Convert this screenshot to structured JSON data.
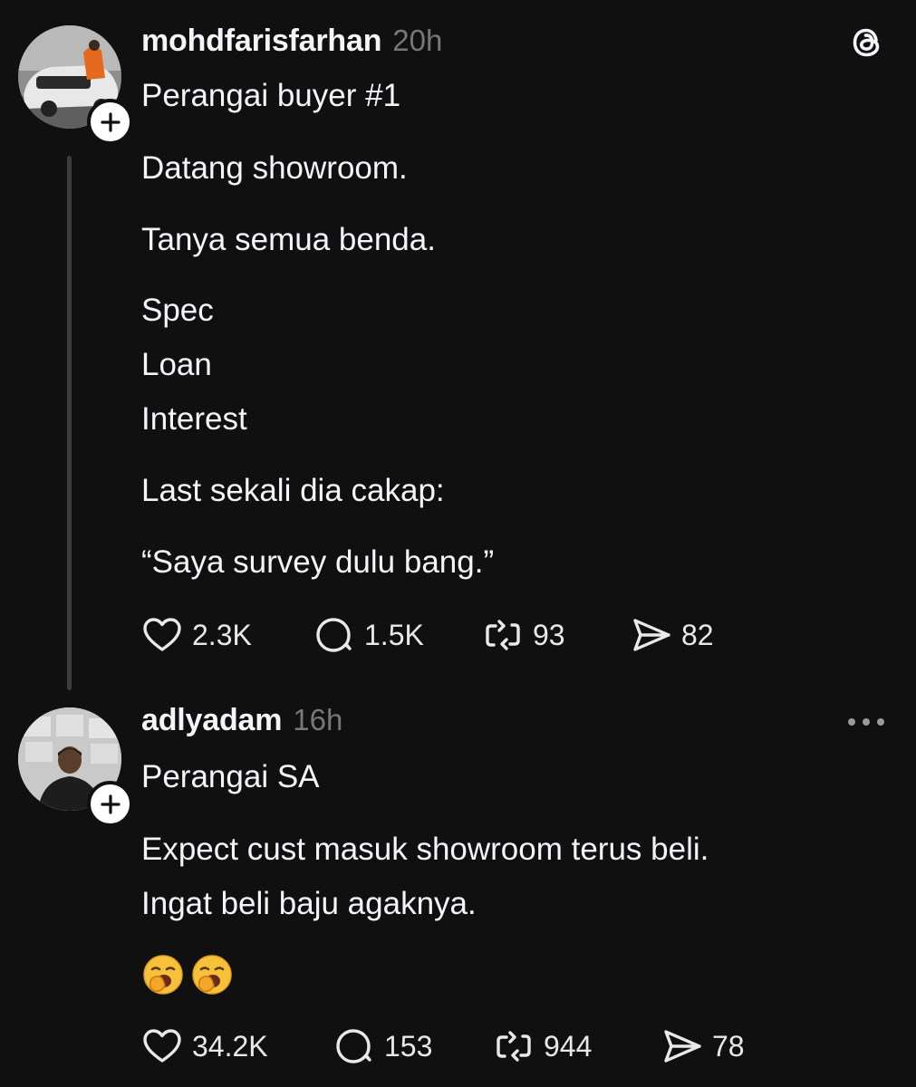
{
  "header_icon": "threads-logo-icon",
  "posts": [
    {
      "username": "mohdfarisfarhan",
      "time": "20h",
      "avatar_icon": "car-photo-avatar",
      "lines": [
        "Perangai buyer #1",
        "Datang showroom.",
        "Tanya semua benda.",
        "Spec",
        "Loan",
        "Interest",
        "Last sekali dia cakap:",
        "“Saya survey dulu bang.”"
      ],
      "likes": "2.3K",
      "replies": "1.5K",
      "reposts": "93",
      "shares": "82"
    },
    {
      "username": "adlyadam",
      "time": "16h",
      "avatar_icon": "person-photo-avatar",
      "lines": [
        "Perangai SA",
        "Expect cust masuk showroom terus beli.",
        "Ingat beli baju agaknya."
      ],
      "emoji": [
        "yawning-face-emoji",
        "yawning-face-emoji"
      ],
      "likes": "34.2K",
      "replies": "153",
      "reposts": "944",
      "shares": "78"
    }
  ],
  "colors": {
    "background": "#101010",
    "text": "#f3f5f7",
    "muted": "#777777",
    "thread_line": "#3c3c3c"
  }
}
